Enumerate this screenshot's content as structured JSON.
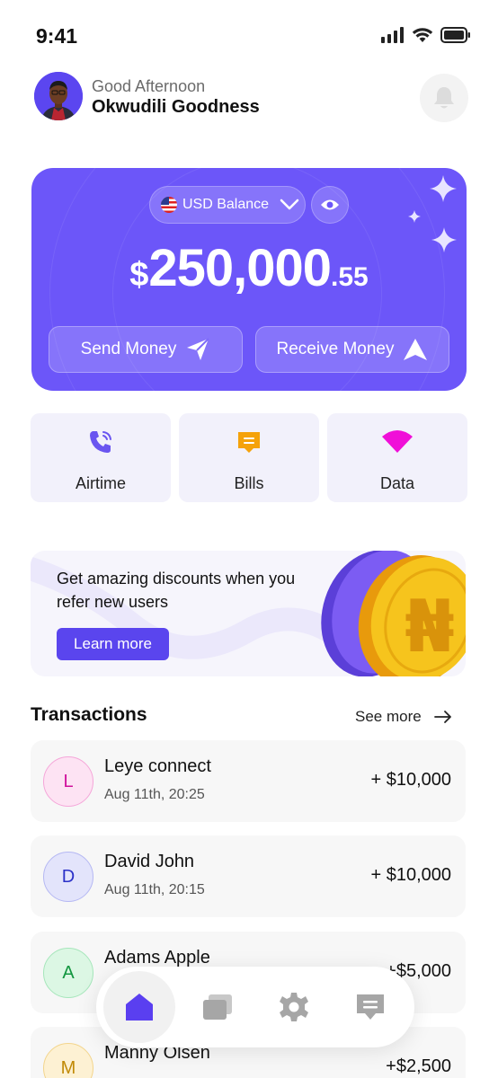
{
  "status_bar": {
    "time": "9:41"
  },
  "header": {
    "greeting": "Good Afternoon",
    "username": "Okwudili Goodness"
  },
  "balance_card": {
    "currency_label": "USD Balance",
    "amount_symbol": "$",
    "amount_main": "250,000",
    "amount_decimal": ".55",
    "send_label": "Send Money",
    "receive_label": "Receive Money",
    "accent_color": "#6c56f9"
  },
  "services": [
    {
      "label": "Airtime",
      "icon": "phone-icon",
      "color": "#6a55f0"
    },
    {
      "label": "Bills",
      "icon": "receipt-icon",
      "color": "#f5a20a"
    },
    {
      "label": "Data",
      "icon": "wifi-icon",
      "color": "#f00fd8"
    }
  ],
  "promo": {
    "text": "Get amazing discounts when you refer new users",
    "button_label": "Learn more",
    "coin_symbol": "₦"
  },
  "transactions": {
    "title": "Transactions",
    "see_more": "See more",
    "items": [
      {
        "initial": "L",
        "name": "Leye connect",
        "date": "Aug 11th, 20:25",
        "amount": "+ $10,000",
        "avatar_bg": "#fde3f3",
        "avatar_border": "#f5a6d9",
        "avatar_color": "#d0119b"
      },
      {
        "initial": "D",
        "name": "David John",
        "date": "Aug 11th, 20:15",
        "amount": "+ $10,000",
        "avatar_bg": "#e3e4fb",
        "avatar_border": "#b5b8f3",
        "avatar_color": "#2b31c8"
      },
      {
        "initial": "A",
        "name": "Adams Apple",
        "date": "",
        "amount": "+$5,000",
        "avatar_bg": "#dcf7e4",
        "avatar_border": "#a6e6bb",
        "avatar_color": "#12963f"
      },
      {
        "initial": "M",
        "name": "Manny Olsen",
        "date": "",
        "amount": "+$2,500",
        "avatar_bg": "#fdf1d3",
        "avatar_border": "#f3d58c",
        "avatar_color": "#c18a06"
      }
    ]
  },
  "bottom_nav": {
    "items": [
      "home-icon",
      "cards-icon",
      "settings-icon",
      "messages-icon"
    ],
    "active": "home-icon"
  }
}
